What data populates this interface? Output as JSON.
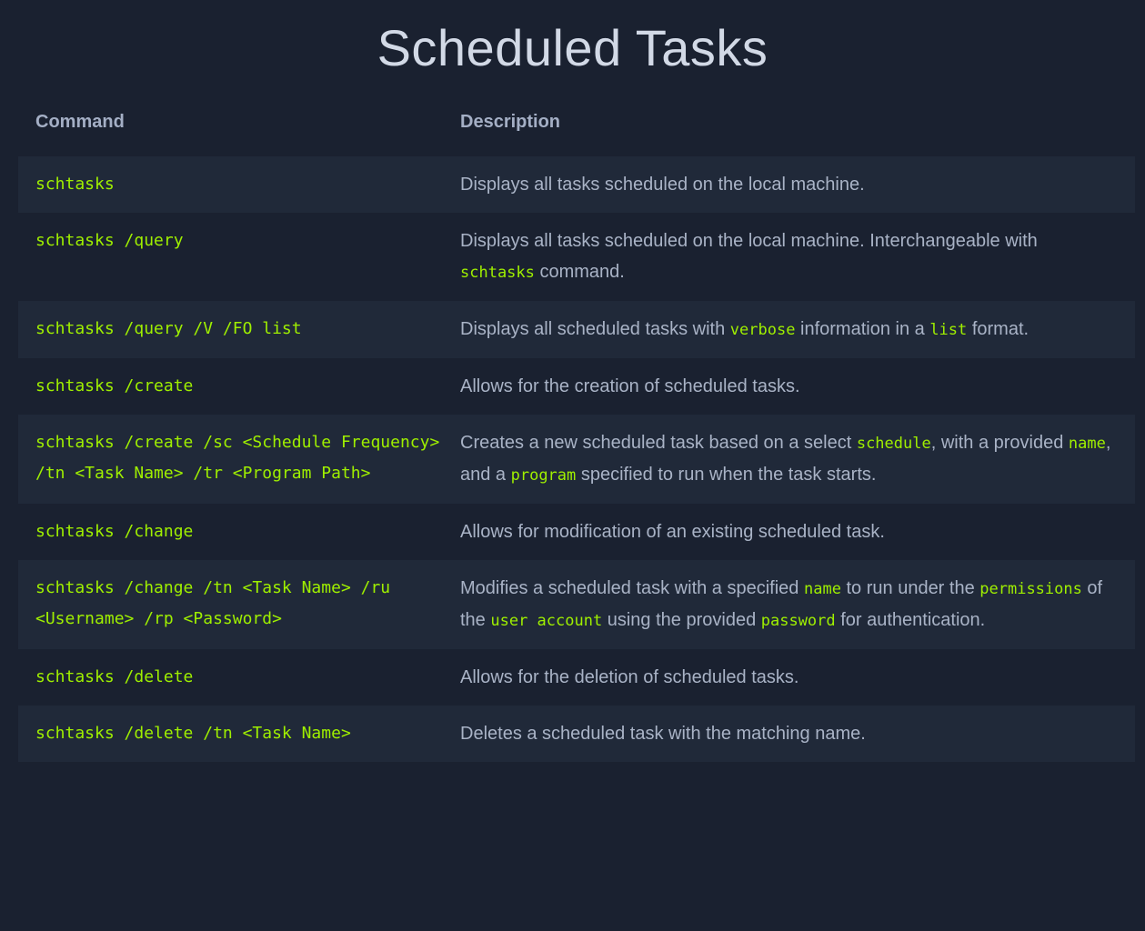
{
  "title": "Scheduled Tasks",
  "table": {
    "headers": {
      "command": "Command",
      "description": "Description"
    },
    "rows": [
      {
        "command": "schtasks",
        "description": [
          {
            "t": "Displays all tasks scheduled on the local machine."
          }
        ]
      },
      {
        "command": "schtasks /query",
        "description": [
          {
            "t": "Displays all tasks scheduled on the local machine. Interchangeable with "
          },
          {
            "c": "schtasks"
          },
          {
            "t": " command."
          }
        ]
      },
      {
        "command": "schtasks /query /V /FO list",
        "description": [
          {
            "t": "Displays all scheduled tasks with "
          },
          {
            "c": "verbose"
          },
          {
            "t": " information in a "
          },
          {
            "c": "list"
          },
          {
            "t": " format."
          }
        ]
      },
      {
        "command": "schtasks /create",
        "description": [
          {
            "t": "Allows for the creation of scheduled tasks."
          }
        ]
      },
      {
        "command": "schtasks /create /sc <Schedule Frequency> /tn <Task Name> /tr <Program Path>",
        "description": [
          {
            "t": "Creates a new scheduled task based on a select "
          },
          {
            "c": "schedule"
          },
          {
            "t": ", with a provided "
          },
          {
            "c": "name"
          },
          {
            "t": ", and a "
          },
          {
            "c": "program"
          },
          {
            "t": " specified to run when the task starts."
          }
        ]
      },
      {
        "command": "schtasks /change",
        "description": [
          {
            "t": "Allows for modification of an existing scheduled task."
          }
        ]
      },
      {
        "command": "schtasks /change /tn <Task Name> /ru <Username> /rp <Password>",
        "description": [
          {
            "t": "Modifies a scheduled task with a specified "
          },
          {
            "c": "name"
          },
          {
            "t": " to run under the "
          },
          {
            "c": "permissions"
          },
          {
            "t": " of the "
          },
          {
            "c": "user account"
          },
          {
            "t": " using the provided "
          },
          {
            "c": "password"
          },
          {
            "t": " for authentication."
          }
        ]
      },
      {
        "command": "schtasks /delete",
        "description": [
          {
            "t": "Allows for the deletion of scheduled tasks."
          }
        ]
      },
      {
        "command": "schtasks /delete /tn <Task Name>",
        "description": [
          {
            "t": "Deletes a scheduled task with the matching name."
          }
        ]
      }
    ]
  },
  "colors": {
    "background": "#1a2130",
    "row_alt": "#202939",
    "code_accent": "#9fef00",
    "title": "#d2d9e6",
    "text": "#a9b3c6"
  }
}
